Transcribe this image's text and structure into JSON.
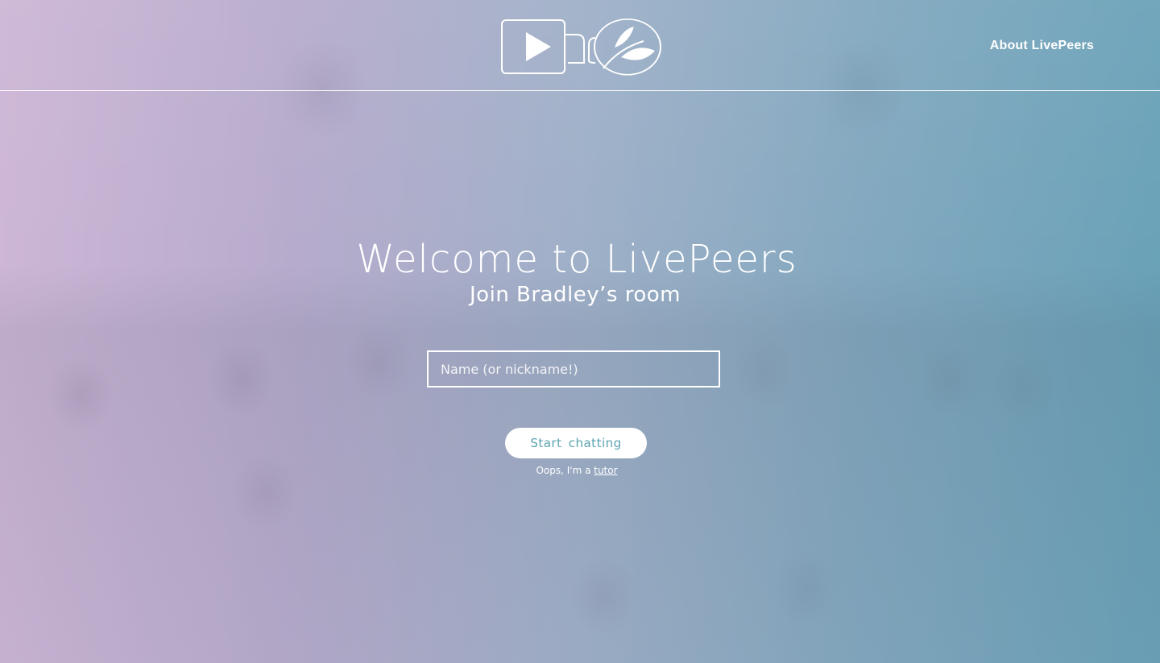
{
  "header": {
    "about_link": "About LivePeers"
  },
  "hero": {
    "title": "Welcome to LivePeers",
    "subtitle": "Join Bradley’s room"
  },
  "form": {
    "name_placeholder": "Name (or nickname!)",
    "name_value": "",
    "start_button": "Start  chatting"
  },
  "tutor_prompt": {
    "text": "Oops, I'm a ",
    "link": "tutor"
  },
  "icons": {
    "logo_left": "video-camera-play-icon",
    "logo_right": "leaf-bulb-icon"
  },
  "colors": {
    "button_text": "#5ba3b1",
    "overlay_left": "#cdb6d6",
    "overlay_right": "#6aa2b8"
  }
}
